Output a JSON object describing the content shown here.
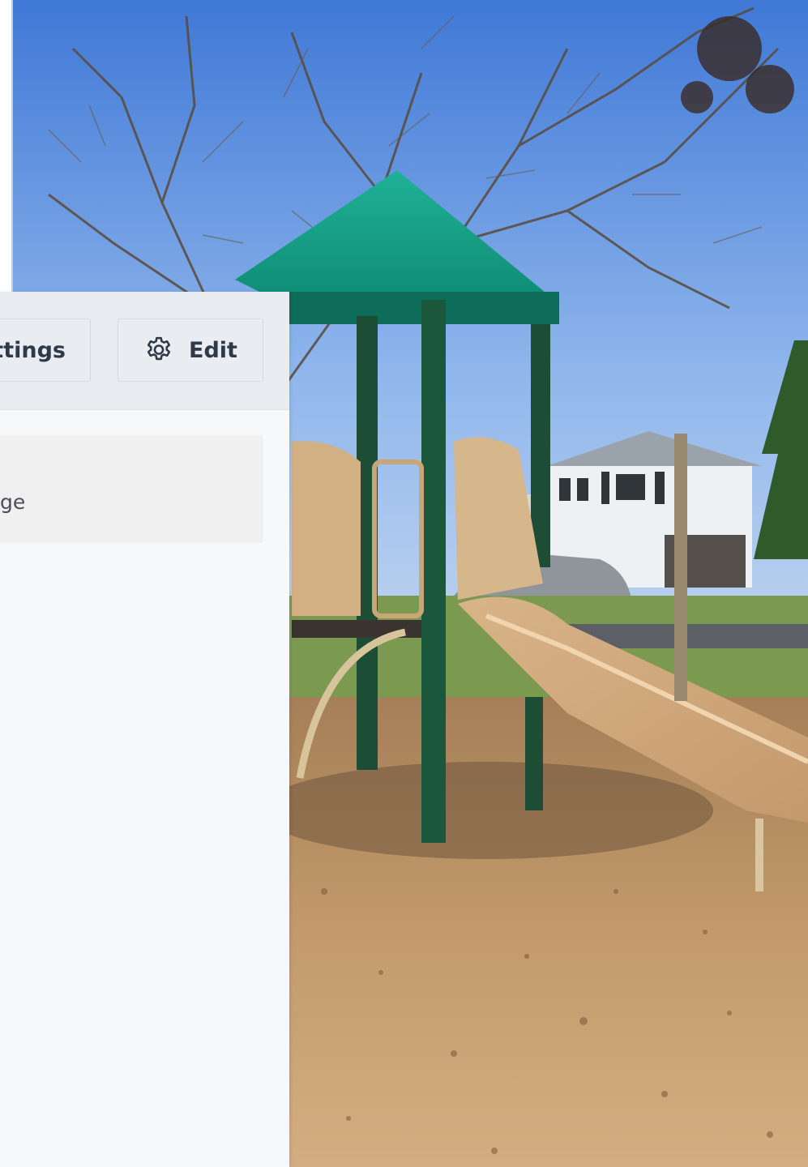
{
  "header": {
    "settings_label": "ettings",
    "edit_label": "Edit"
  },
  "card": {
    "text": "ge"
  },
  "icons": {
    "edit": "gear-icon"
  },
  "colors": {
    "panel_bg": "#f7f8fa",
    "header_bg": "#e9edf2",
    "card_bg": "#f0f0f0",
    "text": "#2f3a48"
  }
}
